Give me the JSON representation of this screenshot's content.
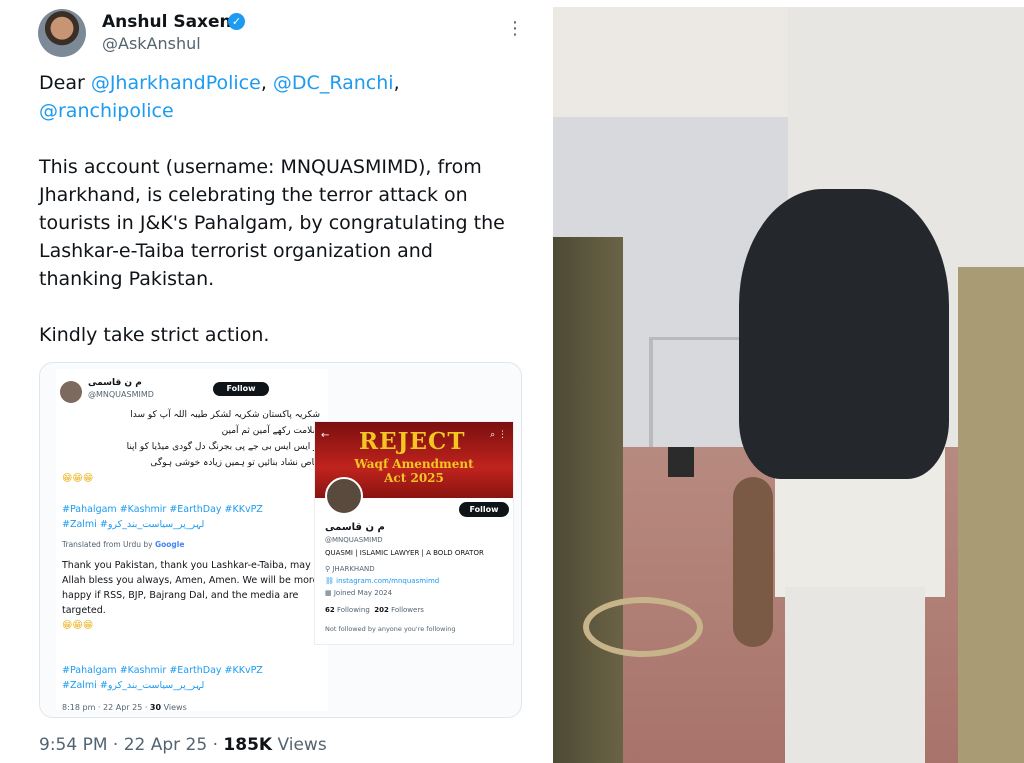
{
  "tweet": {
    "author_name": "Anshul Saxena",
    "author_handle": "@AskAnshul",
    "more_icon": "more-icon",
    "greeting": "Dear",
    "mention1": "@JharkhandPolice",
    "sep1": ",",
    "mention2": "@DC_Ranchi",
    "sep2": ",",
    "mention3": "@ranchipolice",
    "body": "This account (username: MNQUASMIMD), from Jharkhand, is celebrating the terror attack on tourists in  J&K's Pahalgam, by congratulating the Lashkar-e-Taiba terrorist organization and thanking Pakistan.",
    "closing": "Kindly take strict action.",
    "time": "9:54 PM · 22 Apr 25 · ",
    "views_count": "185K",
    "views_label": " Views"
  },
  "quoted": {
    "name": "م ن قاسمی",
    "handle": "@MNQUASMIMD",
    "follow_label": "Follow",
    "urdu_line1": "شکریہ پاکستان شکریہ لشکر طیبہ اللہ آپ کو سدا",
    "urdu_line2": "سلامت رکھے آمین ثم آمین",
    "urdu_line3": "ار ایس ایس بی جے پی بجرنگ دل گودی میڈیا کو اپنا",
    "urdu_line4": "خاص نشاد بنائیں تو ہمیں زیادہ خوشی ہوگی",
    "emoji1": "😁😁😁",
    "hashtags": "#Pahalgam #Kashmir #EarthDay #KKvPZ",
    "hashtags_urdu": "#Zalmi #لہر_پر_سیاست_بند_کرو",
    "translated_label": "Translated from Urdu by",
    "translated_brand": "Google",
    "translation": "Thank you Pakistan, thank you Lashkar-e-Taiba, may Allah bless you always, Amen, Amen. We will be more happy if RSS, BJP, Bajrang Dal, and the media are targeted.",
    "emoji2": "😁😁😁",
    "hashtags2": "#Pahalgam #Kashmir #EarthDay #KKvPZ",
    "hashtags2_urdu": "#Zalmi #لہر_پر_سیاست_بند_کرو",
    "meta_time": "8:18 pm · 22 Apr 25 · ",
    "meta_views": "30",
    "meta_views_label": " Views"
  },
  "profile": {
    "banner_title": "REJECT",
    "banner_subtitle": "Waqf Amendment Act 2025",
    "follow_label": "Follow",
    "name": "م ن قاسمی",
    "handle": "@MNQUASMIMD",
    "bio": "QUASMI | ISLAMIC LAWYER | A BOLD ORATOR",
    "location": "JHARKHAND",
    "link": "instagram.com/mnquasmimd",
    "joined": "Joined May 2024",
    "following_count": "62",
    "following_label": " Following",
    "followers_count": "202",
    "followers_label": " Followers",
    "not_followed": "Not followed by anyone you're following"
  },
  "colors": {
    "link": "#1d9bf0",
    "text": "#0f1419",
    "muted": "#536471",
    "verified": "#1d9bf0"
  }
}
